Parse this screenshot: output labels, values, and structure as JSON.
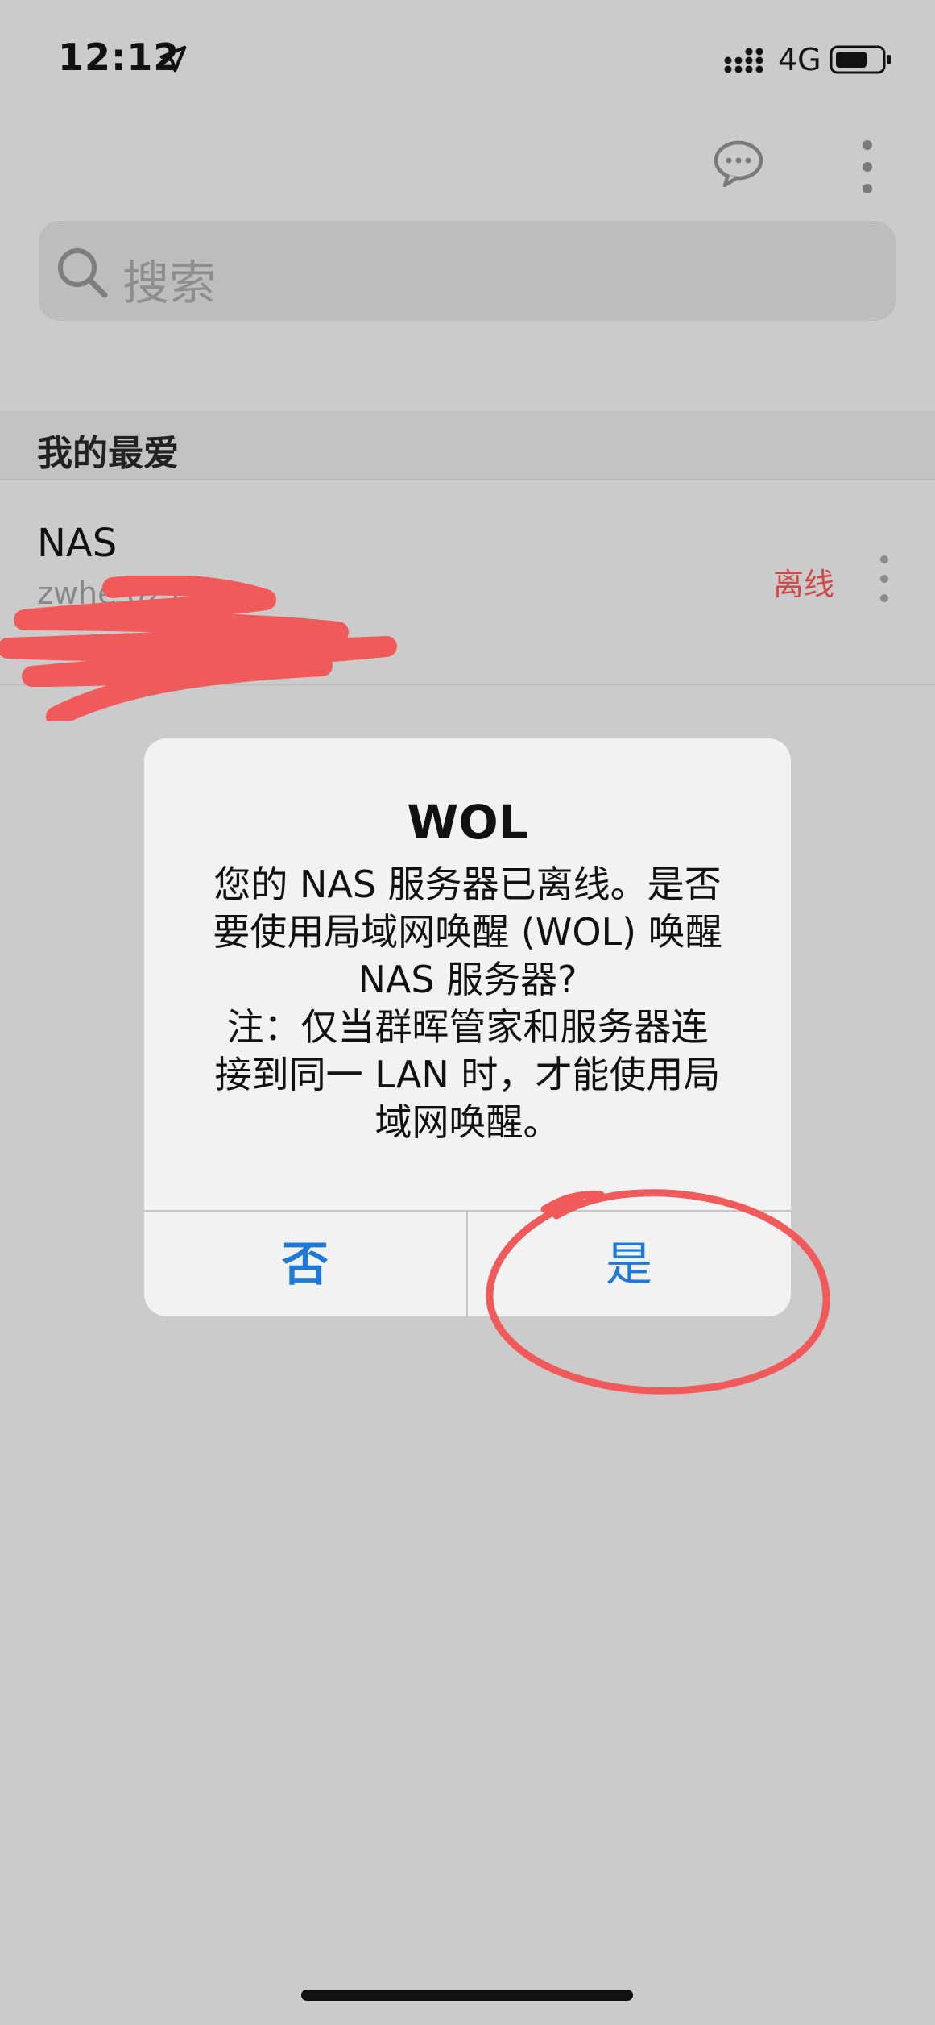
{
  "status_bar": {
    "time": "12:12",
    "network": "4G"
  },
  "search": {
    "placeholder": "搜索"
  },
  "favorites": {
    "title": "我的最爱",
    "devices": [
      {
        "name": "NAS",
        "subtitle": "zwhe    021",
        "status": "离线"
      }
    ]
  },
  "dialog": {
    "title": "WOL",
    "message_lines": [
      "您的 NAS 服务器已离线。是否",
      "要使用局域网唤醒 (WOL) 唤醒",
      "NAS 服务器?",
      "注：仅当群晖管家和服务器连",
      "接到同一 LAN 时，才能使用局",
      "域网唤醒。"
    ],
    "no_label": "否",
    "yes_label": "是"
  },
  "colors": {
    "background": "#cbcbcb",
    "dialog_button": "#1d78d6",
    "offline_status": "#d04a4a",
    "annotation": "#f05a5a"
  },
  "icons": [
    "location-arrow-icon",
    "signal-icon",
    "battery-icon",
    "chat-icon",
    "more-vertical-icon",
    "search-icon"
  ]
}
